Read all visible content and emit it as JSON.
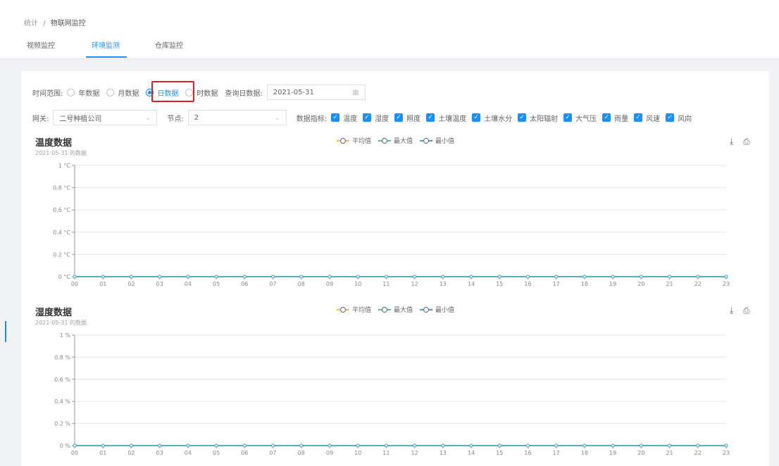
{
  "breadcrumb": {
    "parent": "统计",
    "sep": "/",
    "current": "物联网监控"
  },
  "tabs": [
    {
      "label": "视频监控",
      "active": false
    },
    {
      "label": "环境监测",
      "active": true
    },
    {
      "label": "仓库监控",
      "active": false
    }
  ],
  "filters": {
    "time_range_label": "时间范围:",
    "radios": [
      {
        "label": "年数据",
        "checked": false
      },
      {
        "label": "月数据",
        "checked": false
      },
      {
        "label": "日数据",
        "checked": true
      },
      {
        "label": "时数据",
        "checked": false
      }
    ],
    "query_label": "查询日数据:",
    "date_value": "2021-05-31",
    "date_icon": "calendar-icon",
    "gateway_label": "网关:",
    "gateway_value": "二号种植公司",
    "node_label": "节点:",
    "node_value": "2",
    "metrics_label": "数据指标:",
    "metrics": [
      "温度",
      "湿度",
      "照度",
      "土壤温度",
      "土壤水分",
      "太阳辐射",
      "大气压",
      "雨量",
      "风速",
      "风向"
    ]
  },
  "colors": {
    "accent": "#1890ff",
    "avg": "#f4c24d",
    "max": "#49c6b0",
    "min": "#3fa2c8",
    "highlight": "#e02020"
  },
  "legend": [
    "平均值",
    "最大值",
    "最小值"
  ],
  "charts": [
    {
      "title": "温度数据",
      "subtitle": "2021-05-31 的数据",
      "y_ticks": [
        "0 °C",
        "0.2 °C",
        "0.4 °C",
        "0.6 °C",
        "0.8 °C",
        "1 °C"
      ],
      "x_ticks": [
        "00",
        "01",
        "02",
        "03",
        "04",
        "05",
        "06",
        "07",
        "08",
        "09",
        "10",
        "11",
        "12",
        "13",
        "14",
        "15",
        "16",
        "17",
        "18",
        "19",
        "20",
        "21",
        "22",
        "23"
      ]
    },
    {
      "title": "湿度数据",
      "subtitle": "2021-05-31 的数据",
      "y_ticks": [
        "0 %",
        "0.2 %",
        "0.4 %",
        "0.6 %",
        "0.8 %",
        "1 %"
      ],
      "x_ticks": [
        "00",
        "01",
        "02",
        "03",
        "04",
        "05",
        "06",
        "07",
        "08",
        "09",
        "10",
        "11",
        "12",
        "13",
        "14",
        "15",
        "16",
        "17",
        "18",
        "19",
        "20",
        "21",
        "22",
        "23"
      ]
    }
  ],
  "chart_data": [
    {
      "type": "line",
      "title": "温度数据",
      "subtitle": "2021-05-31 的数据",
      "x": [
        "00",
        "01",
        "02",
        "03",
        "04",
        "05",
        "06",
        "07",
        "08",
        "09",
        "10",
        "11",
        "12",
        "13",
        "14",
        "15",
        "16",
        "17",
        "18",
        "19",
        "20",
        "21",
        "22",
        "23"
      ],
      "ylim": [
        0,
        1
      ],
      "grid": true,
      "legend_position": "top-center",
      "series": [
        {
          "name": "平均值",
          "values": [
            0,
            0,
            0,
            0,
            0,
            0,
            0,
            0,
            0,
            0,
            0,
            0,
            0,
            0,
            0,
            0,
            0,
            0,
            0,
            0,
            0,
            0,
            0,
            0
          ]
        },
        {
          "name": "最大值",
          "values": [
            0,
            0,
            0,
            0,
            0,
            0,
            0,
            0,
            0,
            0,
            0,
            0,
            0,
            0,
            0,
            0,
            0,
            0,
            0,
            0,
            0,
            0,
            0,
            0
          ]
        },
        {
          "name": "最小值",
          "values": [
            0,
            0,
            0,
            0,
            0,
            0,
            0,
            0,
            0,
            0,
            0,
            0,
            0,
            0,
            0,
            0,
            0,
            0,
            0,
            0,
            0,
            0,
            0,
            0
          ]
        }
      ]
    },
    {
      "type": "line",
      "title": "湿度数据",
      "subtitle": "2021-05-31 的数据",
      "x": [
        "00",
        "01",
        "02",
        "03",
        "04",
        "05",
        "06",
        "07",
        "08",
        "09",
        "10",
        "11",
        "12",
        "13",
        "14",
        "15",
        "16",
        "17",
        "18",
        "19",
        "20",
        "21",
        "22",
        "23"
      ],
      "ylim": [
        0,
        1
      ],
      "grid": true,
      "legend_position": "top-center",
      "series": [
        {
          "name": "平均值",
          "values": [
            0,
            0,
            0,
            0,
            0,
            0,
            0,
            0,
            0,
            0,
            0,
            0,
            0,
            0,
            0,
            0,
            0,
            0,
            0,
            0,
            0,
            0,
            0,
            0
          ]
        },
        {
          "name": "最大值",
          "values": [
            0,
            0,
            0,
            0,
            0,
            0,
            0,
            0,
            0,
            0,
            0,
            0,
            0,
            0,
            0,
            0,
            0,
            0,
            0,
            0,
            0,
            0,
            0,
            0
          ]
        },
        {
          "name": "最小值",
          "values": [
            0,
            0,
            0,
            0,
            0,
            0,
            0,
            0,
            0,
            0,
            0,
            0,
            0,
            0,
            0,
            0,
            0,
            0,
            0,
            0,
            0,
            0,
            0,
            0
          ]
        }
      ]
    }
  ]
}
